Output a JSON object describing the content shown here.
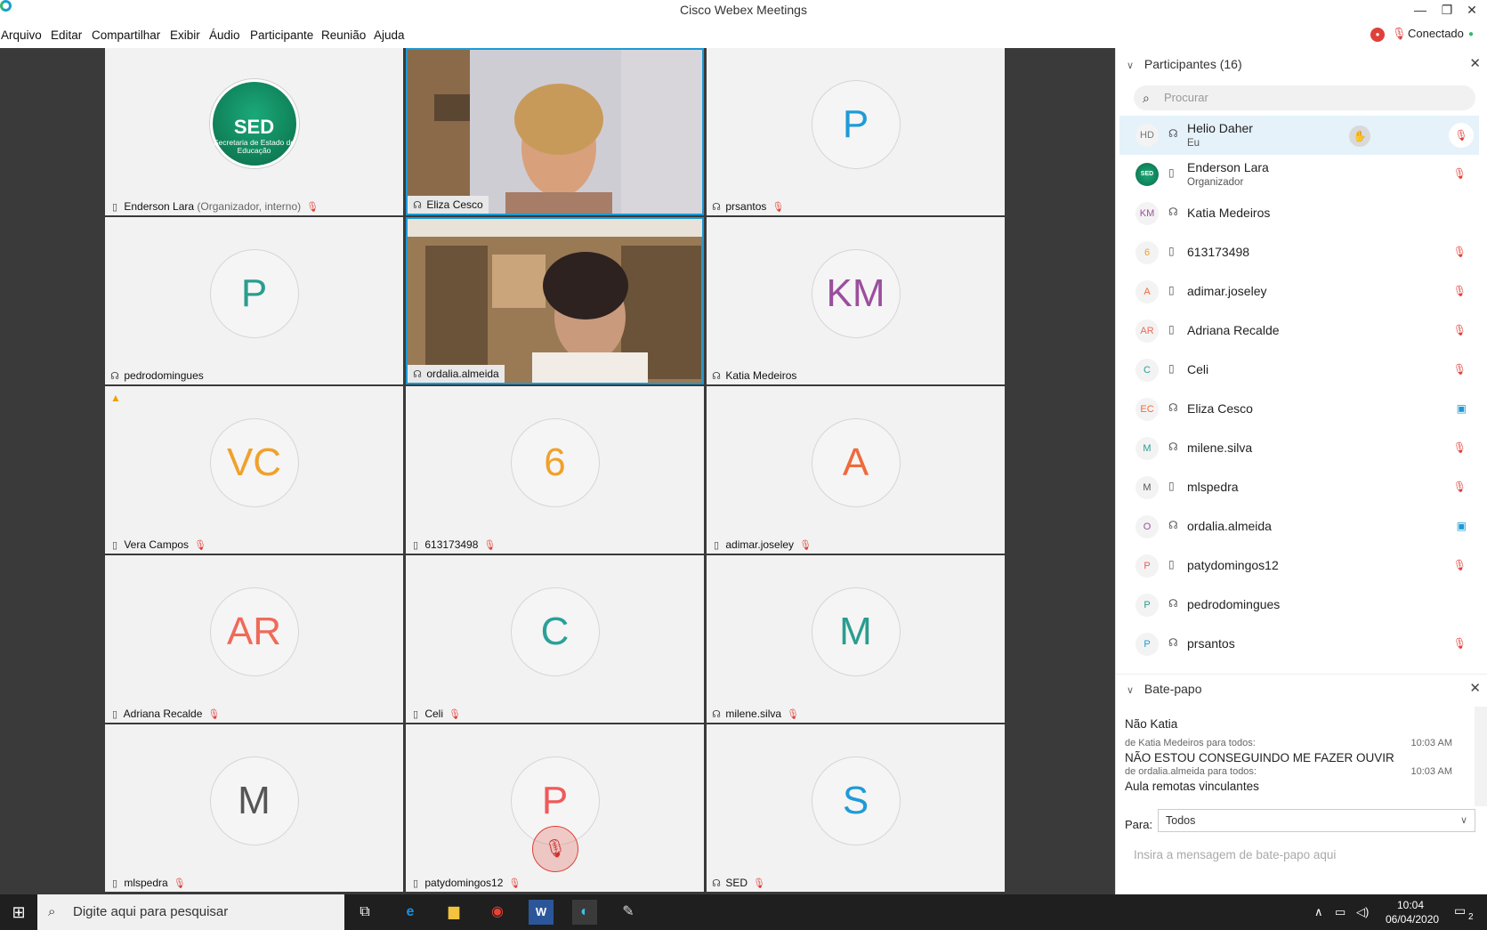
{
  "window": {
    "title": "Cisco Webex Meetings",
    "minimize": "—",
    "restore": "❐",
    "close": "✕"
  },
  "menu": [
    {
      "label": "Arquivo"
    },
    {
      "label": "Editar"
    },
    {
      "label": "Compartilhar"
    },
    {
      "label": "Exibir"
    },
    {
      "label": "Áudio"
    },
    {
      "label": "Participante"
    },
    {
      "label": "Reunião"
    },
    {
      "label": "Ajuda"
    }
  ],
  "connection": {
    "status": "Conectado",
    "recording_dot": "●"
  },
  "grid": [
    {
      "name": "Enderson Lara",
      "sub": " (Organizador, interno)",
      "initials": "",
      "logo": true,
      "logo_big": "SED",
      "logo_small": "Secretaria de Estado de Educação",
      "device": "▯",
      "mute": "🎙"
    },
    {
      "name": "Eliza Cesco",
      "video": true,
      "device": "☊"
    },
    {
      "name": "prsantos",
      "initials": "P",
      "color": "#1f9bd7",
      "device": "☊",
      "mute": "🎙"
    },
    {
      "name": "pedrodomingues",
      "initials": "P",
      "color": "#2a9d8f",
      "device": "☊"
    },
    {
      "name": "ordalia.almeida",
      "video": true,
      "device": "☊"
    },
    {
      "name": "Katia Medeiros",
      "initials": "KM",
      "color": "#9b4f9e",
      "device": "☊"
    },
    {
      "name": "Vera Campos",
      "initials": "VC",
      "color": "#f0a12b",
      "device": "▯",
      "mute": "🎙",
      "warn": "▲"
    },
    {
      "name": "613173498",
      "initials": "6",
      "color": "#f0a12b",
      "device": "▯",
      "mute": "🎙"
    },
    {
      "name": "adimar.joseley",
      "initials": "A",
      "color": "#ee6b3b",
      "device": "▯",
      "mute": "🎙"
    },
    {
      "name": "Adriana Recalde",
      "initials": "AR",
      "color": "#ef6a5a",
      "device": "▯",
      "mute": "🎙"
    },
    {
      "name": "Celi",
      "initials": "C",
      "color": "#2aa198",
      "device": "▯",
      "mute": "🎙"
    },
    {
      "name": "milene.silva",
      "initials": "M",
      "color": "#2a9d8f",
      "device": "☊",
      "mute": "🎙"
    },
    {
      "name": "mlspedra",
      "initials": "M",
      "color": "#555555",
      "device": "▯",
      "mute": "🎙"
    },
    {
      "name": "patydomingos12",
      "initials": "P",
      "color": "#ef5a5a",
      "device": "▯",
      "mute": "🎙",
      "bigmute": "🎙"
    },
    {
      "name": "SED",
      "initials": "S",
      "color": "#1f9bd7",
      "device": "☊",
      "mute": "🎙"
    }
  ],
  "participants_panel": {
    "title": "Participantes (16)",
    "search_placeholder": "Procurar",
    "items": [
      {
        "initials": "HD",
        "color": "#777777",
        "device": "☊",
        "name": "Helio Daher",
        "role": "Eu",
        "hand": "✋",
        "state": "🎙",
        "selected": true
      },
      {
        "initials": "SED",
        "color": "#ffffff",
        "device": "▯",
        "name": "Enderson Lara",
        "role": "Organizador",
        "state": "🎙",
        "logo": true
      },
      {
        "initials": "KM",
        "color": "#9b4f9e",
        "device": "☊",
        "name": "Katia Medeiros",
        "role": "",
        "state": ""
      },
      {
        "initials": "6",
        "color": "#f0a12b",
        "device": "▯",
        "name": "613173498",
        "role": "",
        "state": "🎙"
      },
      {
        "initials": "A",
        "color": "#ee6b3b",
        "device": "▯",
        "name": "adimar.joseley",
        "role": "",
        "state": "🎙"
      },
      {
        "initials": "AR",
        "color": "#ef6a5a",
        "device": "▯",
        "name": "Adriana Recalde",
        "role": "",
        "state": "🎙"
      },
      {
        "initials": "C",
        "color": "#2aa198",
        "device": "▯",
        "name": "Celi",
        "role": "",
        "state": "🎙"
      },
      {
        "initials": "EC",
        "color": "#ee6b3b",
        "device": "☊",
        "name": "Eliza Cesco",
        "role": "",
        "state": "▣"
      },
      {
        "initials": "M",
        "color": "#2a9d8f",
        "device": "☊",
        "name": "milene.silva",
        "role": "",
        "state": "🎙"
      },
      {
        "initials": "M",
        "color": "#555555",
        "device": "▯",
        "name": "mlspedra",
        "role": "",
        "state": "🎙"
      },
      {
        "initials": "O",
        "color": "#9b4f9e",
        "device": "☊",
        "name": "ordalia.almeida",
        "role": "",
        "state": "▣"
      },
      {
        "initials": "P",
        "color": "#ef5a5a",
        "device": "▯",
        "name": "patydomingos12",
        "role": "",
        "state": "🎙"
      },
      {
        "initials": "P",
        "color": "#2a9d8f",
        "device": "☊",
        "name": "pedrodomingues",
        "role": "",
        "state": ""
      },
      {
        "initials": "P",
        "color": "#1f9bd7",
        "device": "☊",
        "name": "prsantos",
        "role": "",
        "state": "🎙"
      }
    ]
  },
  "chat_panel": {
    "title": "Bate-papo",
    "messages": [
      {
        "meta": "de ordalia.almeida para todos:",
        "time": "10:03 AM",
        "text": "Não Katia"
      },
      {
        "meta": "de Katia Medeiros para todos:",
        "time": "10:03 AM",
        "text": "NÃO ESTOU CONSEGUINDO ME FAZER OUVIR"
      },
      {
        "meta": "de ordalia.almeida para todos:",
        "time": "10:03 AM",
        "text": "Aula remotas vinculantes"
      }
    ],
    "to_label": "Para:",
    "to_value": "Todos",
    "input_placeholder": "Insira a mensagem de bate-papo aqui"
  },
  "taskbar": {
    "search_placeholder": "Digite aqui para pesquisar",
    "time": "10:04",
    "date": "06/04/2020",
    "notifications": "2"
  },
  "colors": {
    "accent": "#1c9ad6",
    "mute_red": "#e0403a",
    "stage_bg": "#3a3a3a"
  }
}
